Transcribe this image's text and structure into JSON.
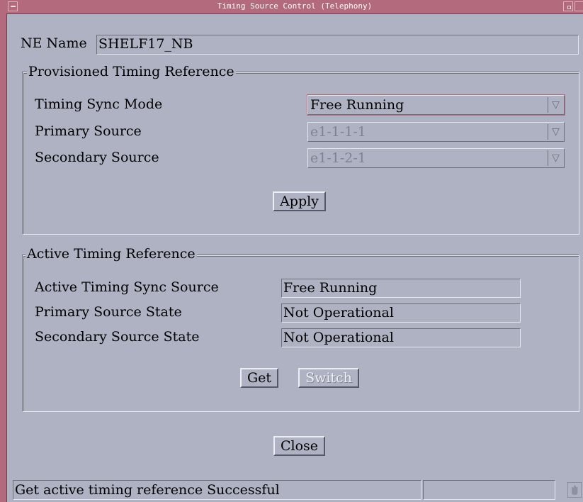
{
  "window": {
    "title": "Timing Source Control (Telephony)"
  },
  "ne": {
    "label": "NE Name",
    "value": "SHELF17_NB"
  },
  "provisioned": {
    "title": "Provisioned Timing Reference",
    "sync_mode_label": "Timing Sync Mode",
    "sync_mode_value": "Free Running",
    "primary_label": "Primary Source",
    "primary_value": "e1-1-1-1",
    "secondary_label": "Secondary Source",
    "secondary_value": "e1-1-2-1",
    "apply_label": "Apply"
  },
  "active": {
    "title": "Active Timing Reference",
    "sync_source_label": "Active Timing Sync Source",
    "sync_source_value": "Free Running",
    "primary_state_label": "Primary Source State",
    "primary_state_value": "Not Operational",
    "secondary_state_label": "Secondary Source State",
    "secondary_state_value": "Not Operational",
    "get_label": "Get",
    "switch_label": "Switch"
  },
  "close_label": "Close",
  "statusbar": {
    "message": "Get active timing reference Successful",
    "secondary": ""
  },
  "colors": {
    "background": "#aeb2c3",
    "frame": "#b36a7c",
    "focus": "#b36a7c"
  },
  "icons": {
    "window_menu": "window-menu-icon",
    "minimize": "minimize-icon",
    "maximize": "maximize-icon",
    "dropdown": "dropdown-arrow-icon",
    "busy": "busy-indicator-icon"
  }
}
